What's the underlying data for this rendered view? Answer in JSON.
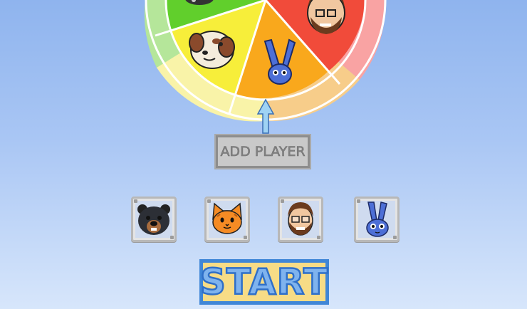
{
  "wheel": {
    "segments": [
      {
        "name": "dog",
        "color": "#f7ee3a"
      },
      {
        "name": "bunny",
        "color": "#f9a81c"
      },
      {
        "name": "man",
        "color": "#f14b3a"
      },
      {
        "name": "black-cat",
        "color": "#61cf2c"
      }
    ],
    "rim_colors": [
      "#f9f3a8",
      "#f7cd8a",
      "#f9a3a3",
      "#b5e69a"
    ],
    "pointer_color": "#9fd3f4"
  },
  "add_player": {
    "label": "ADD PLAYER"
  },
  "players": [
    {
      "icon": "bear-icon"
    },
    {
      "icon": "cat-icon"
    },
    {
      "icon": "man-icon"
    },
    {
      "icon": "bunny-icon"
    }
  ],
  "start": {
    "label": "START"
  }
}
